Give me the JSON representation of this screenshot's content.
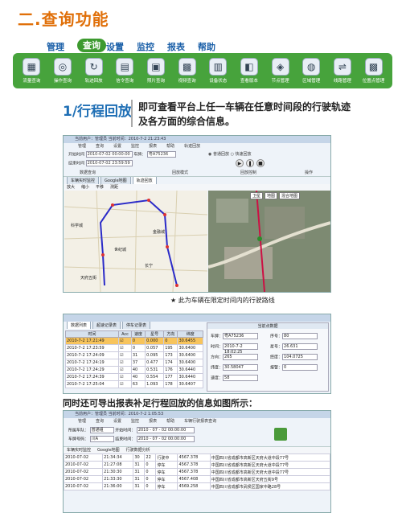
{
  "heading": "二.查询功能",
  "top_menu": [
    "管理",
    "查询",
    "设置",
    "监控",
    "报表",
    "帮助"
  ],
  "top_menu_active": 1,
  "toolbar_icons": [
    {
      "label": "流量查询",
      "icon": "chart-icon"
    },
    {
      "label": "操作查询",
      "icon": "binoculars-icon"
    },
    {
      "label": "轨迹回放",
      "icon": "refresh-icon"
    },
    {
      "label": "信令查询",
      "icon": "document-icon"
    },
    {
      "label": "照片查询",
      "icon": "photo-icon"
    },
    {
      "label": "视频查询",
      "icon": "grid-icon"
    },
    {
      "label": "设备状态",
      "icon": "calculator-icon"
    },
    {
      "label": "查看版本",
      "icon": "window-icon"
    },
    {
      "label": "节点管理",
      "icon": "node-icon"
    },
    {
      "label": "区域管理",
      "icon": "globe-icon"
    },
    {
      "label": "线路管理",
      "icon": "route-icon"
    },
    {
      "label": "位置点管理",
      "icon": "grid-icon"
    }
  ],
  "section": {
    "number": "1/行程回放",
    "description": "即可查看平台上任一车辆在任意时间段的行驶轨迹及各方面的综合信息。"
  },
  "window1": {
    "title": "当前用户：管理员    当前时间：2010-7-2 21:23:43",
    "menu": [
      "管理",
      "查询",
      "设置",
      "监控",
      "报表",
      "帮助",
      "轨迹回放"
    ],
    "start_label": "开始时间",
    "start_value": "2010-07-02 00:00:00",
    "end_label": "结束时间",
    "end_value": "2010-07-02 23:59:59",
    "plate_label": "车牌：",
    "plate_value": "粤A75236",
    "mode_normal": "普通回放",
    "mode_fast": "快速回放",
    "group_query": "数据查询",
    "group_mode": "回放模式",
    "group_control": "回放控制",
    "group_op": "操作",
    "tabs": [
      "车辆实时监控",
      "Google地图",
      "轨迹回放"
    ],
    "map_toolbar": [
      "放大",
      "缩小",
      "平移",
      "测距"
    ],
    "sat_toolbar": [
      "卫星",
      "地图",
      "混合地图"
    ],
    "places": [
      "科学城",
      "金融城",
      "世纪城",
      "长宁",
      "天府五街"
    ]
  },
  "caption1": "★ 此为车辆在限定时间内的行驶路线",
  "window2": {
    "tabs": [
      "数据列表",
      "超速记录表",
      "停车记录表"
    ],
    "columns": [
      "时间",
      "Acc",
      "速度",
      "星号",
      "方向",
      "纬度"
    ],
    "rows": [
      [
        "2010-7-2 17:21:49",
        "",
        "0",
        "0.000",
        "0",
        "30.6455"
      ],
      [
        "2010-7-2 17:23:59",
        "",
        "0",
        "0.057",
        "195",
        "30.6400"
      ],
      [
        "2010-7-2 17:24:09",
        "",
        "31",
        "0.095",
        "173",
        "30.6400"
      ],
      [
        "2010-7-2 17:24:19",
        "",
        "37",
        "0.477",
        "174",
        "30.6400"
      ],
      [
        "2010-7-2 17:24:29",
        "",
        "40",
        "0.531",
        "176",
        "30.6440"
      ],
      [
        "2010-7-2 17:24:39",
        "",
        "40",
        "0.554",
        "177",
        "30.6440"
      ],
      [
        "2010-7-2 17:25:04",
        "",
        "63",
        "1.093",
        "178",
        "30.6407"
      ]
    ],
    "detail_header": "当前点数据",
    "detail": [
      {
        "label": "车牌",
        "value": "粤A75236"
      },
      {
        "label": "时间",
        "value": "2010-7-2 18:02:25"
      },
      {
        "label": "方向",
        "value": "265"
      },
      {
        "label": "纬度",
        "value": "30.58047"
      },
      {
        "label": "速度",
        "value": "58"
      }
    ],
    "detail_right": [
      {
        "label": "序号",
        "value": "80"
      },
      {
        "label": "星号",
        "value": "26.631"
      },
      {
        "label": "经度",
        "value": "104.0725"
      },
      {
        "label": "报警",
        "value": "0"
      }
    ]
  },
  "sentence": "同时还可导出报表补足行程回放的信息如图所示：",
  "window3": {
    "title": "当前用户：管理员    当前时间：2010-7-2 1:05:53",
    "menu": [
      "管理",
      "查询",
      "设置",
      "监控",
      "报表",
      "帮助",
      "车辆行驶报表查询"
    ],
    "row1": [
      "所属车队：",
      "普通组",
      "开始时间：",
      "2010 - 07 - 02  00:00:00"
    ],
    "row2": [
      "车牌号码：",
      "川A",
      "结束时间：",
      "2010 - 07 - 02  00:00:00"
    ],
    "toolbar": [
      "车辆实时监控",
      "Google地图",
      "行驶数据分析"
    ],
    "rows": [
      [
        "2010-07-02",
        "21:34:34",
        "30",
        "22",
        "行驶中",
        "4567.378",
        "中国四川省成都市高新区天府大道中段77号"
      ],
      [
        "2010-07-02",
        "21:27:08",
        "31",
        "0",
        "停车",
        "4567.378",
        "中国四川省成都市高新区天府大道中段77号"
      ],
      [
        "2010-07-02",
        "21:30:30",
        "31",
        "0",
        "停车",
        "4567.378",
        "中国四川省成都市高新区天府大道中段77号"
      ],
      [
        "2010-07-02",
        "21:33:30",
        "31",
        "0",
        "停车",
        "4567.408",
        "中国四川省成都市高新区天府五街9号"
      ],
      [
        "2010-07-02",
        "21:36:00",
        "31",
        "0",
        "停车",
        "4569.258",
        "中国四川省成都市武侯区国家中路28号"
      ]
    ]
  },
  "colors": {
    "orange": "#e0700a",
    "green": "#47a33c",
    "blue": "#1f6fb5"
  }
}
